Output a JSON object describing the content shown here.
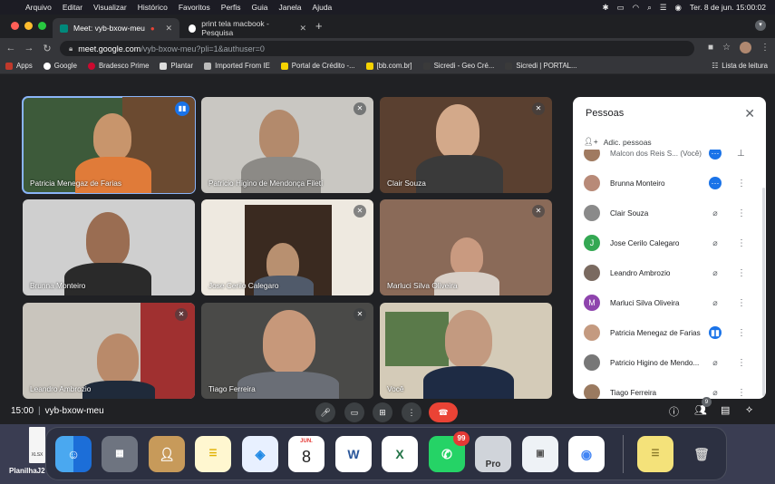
{
  "menubar": {
    "apple": "",
    "items": [
      "Chrome",
      "Arquivo",
      "Editar",
      "Visualizar",
      "Histórico",
      "Favoritos",
      "Perfis",
      "Guia",
      "Janela",
      "Ajuda"
    ],
    "clock": "Ter. 8 de jun.  15:00:02"
  },
  "tabs": [
    {
      "title": "Meet: vyb-bxow-meu",
      "active": true
    },
    {
      "title": "print tela macbook - Pesquisa",
      "active": false
    }
  ],
  "address": {
    "host": "meet.google.com",
    "path": "/vyb-bxow-meu?pli=1&authuser=0"
  },
  "bookmarks": {
    "items": [
      "Apps",
      "Google",
      "Bradesco Prime",
      "Plantar",
      "Imported From IE",
      "Portal de Crédito -...",
      "[bb.com.br]",
      "Sicredi - Geo Cré...",
      "Sicredi | PORTAL..."
    ],
    "reading_list": "Lista de leitura"
  },
  "tiles": [
    {
      "name": "Patricia Menegaz de Farias",
      "state": "speaking"
    },
    {
      "name": "Patricio Higino de Mendonça Filetí",
      "state": "muted"
    },
    {
      "name": "Clair Souza",
      "state": "muted"
    },
    {
      "name": "Brunna Monteiro",
      "state": ""
    },
    {
      "name": "Jose Cerilo Calegaro",
      "state": "muted"
    },
    {
      "name": "Marluci Silva Oliveira",
      "state": "muted"
    },
    {
      "name": "Leandro Ambrozio",
      "state": "muted"
    },
    {
      "name": "Tiago Ferreira",
      "state": "muted"
    },
    {
      "name": "Você",
      "state": ""
    }
  ],
  "panel": {
    "title": "Pessoas",
    "add_people": "Adic. pessoas",
    "people": [
      {
        "name": "Malcon dos Reis S...  (Você)",
        "initial": "",
        "color": "#a07a60",
        "mic": "active"
      },
      {
        "name": "Brunna Monteiro",
        "initial": "",
        "color": "#b88a78",
        "mic": "active"
      },
      {
        "name": "Clair Souza",
        "initial": "",
        "color": "#8a8a8a",
        "mic": "muted"
      },
      {
        "name": "Jose Cerilo Calegaro",
        "initial": "J",
        "color": "#34a853",
        "mic": "muted"
      },
      {
        "name": "Leandro Ambrozio",
        "initial": "",
        "color": "#7a6a60",
        "mic": "muted"
      },
      {
        "name": "Marluci Silva Oliveira",
        "initial": "M",
        "color": "#8e44ad",
        "mic": "muted"
      },
      {
        "name": "Patricia Menegaz de Farias",
        "initial": "",
        "color": "#c49a80",
        "mic": "active"
      },
      {
        "name": "Patricio Higino de Mendo...",
        "initial": "",
        "color": "#777",
        "mic": "muted"
      },
      {
        "name": "Tiago Ferreira",
        "initial": "",
        "color": "#9a7a60",
        "mic": "muted"
      }
    ]
  },
  "bottom": {
    "time": "15:00",
    "code": "vyb-bxow-meu",
    "people_count": "9"
  },
  "desktop": {
    "file": "PlanilhaJ2",
    "file_type": "XLSX"
  },
  "dock": {
    "calendar_month": "JUN.",
    "calendar_day": "8",
    "whatsapp_badge": "99",
    "word_letter": "W",
    "excel_letter": "X",
    "pro_label": "Pro"
  }
}
